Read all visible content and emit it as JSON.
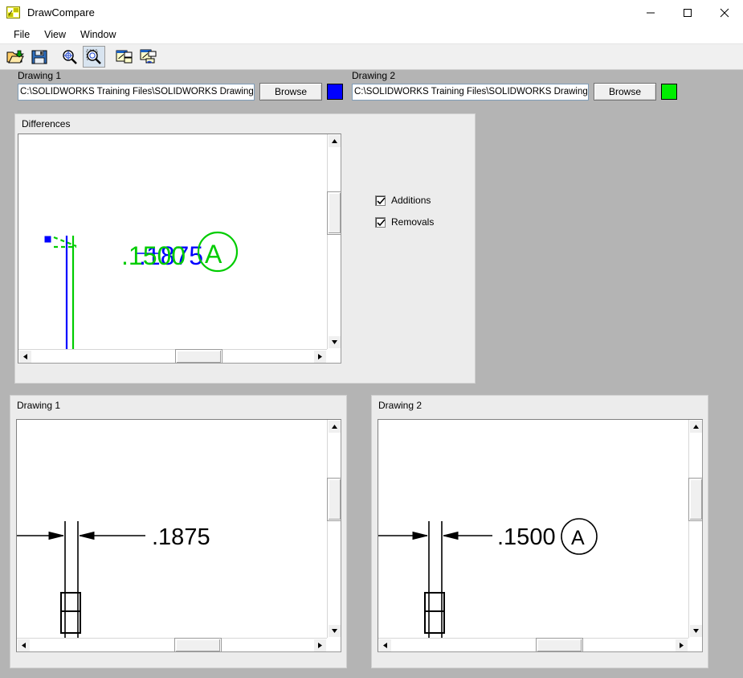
{
  "window": {
    "title": "DrawCompare",
    "icon": "app-icon",
    "minimize_label": "–",
    "maximize_label": "□",
    "close_label": "✕"
  },
  "menu": {
    "items": [
      {
        "label": "File",
        "name": "menu-file"
      },
      {
        "label": "View",
        "name": "menu-view"
      },
      {
        "label": "Window",
        "name": "menu-window"
      }
    ]
  },
  "toolbar": {
    "buttons": [
      {
        "name": "open-icon",
        "title": "Open"
      },
      {
        "name": "save-icon",
        "title": "Save"
      },
      {
        "name": "zoom-fit-icon",
        "title": "Zoom to Fit"
      },
      {
        "name": "zoom-area-icon",
        "title": "Zoom to Area",
        "pressed": true
      },
      {
        "name": "tile-windows-icon",
        "title": "Tile Windows"
      },
      {
        "name": "link-windows-icon",
        "title": "Link Windows"
      }
    ]
  },
  "drawing1": {
    "group_label": "Drawing 1",
    "path": "C:\\SOLIDWORKS Training Files\\SOLIDWORKS Drawings-Al",
    "browse_label": "Browse",
    "color": "#0000FF"
  },
  "drawing2": {
    "group_label": "Drawing 2",
    "path": "C:\\SOLIDWORKS Training Files\\SOLIDWORKS Drawings-Al",
    "browse_label": "Browse",
    "color": "#00EE00"
  },
  "differences": {
    "group_label": "Differences",
    "options": [
      {
        "label": "Additions",
        "checked": true,
        "name": "additions-checkbox"
      },
      {
        "label": "Removals",
        "checked": true,
        "name": "removals-checkbox"
      }
    ],
    "overlay": {
      "removed_dimension": ".1875",
      "removed_color": "#0000FF",
      "added_dimension": ".1500",
      "added_datum": "A",
      "added_color": "#00CC00"
    }
  },
  "panel1": {
    "group_label": "Drawing 1",
    "dimension": ".1875",
    "datum": ""
  },
  "panel2": {
    "group_label": "Drawing 2",
    "dimension": ".1500",
    "datum": "A"
  }
}
